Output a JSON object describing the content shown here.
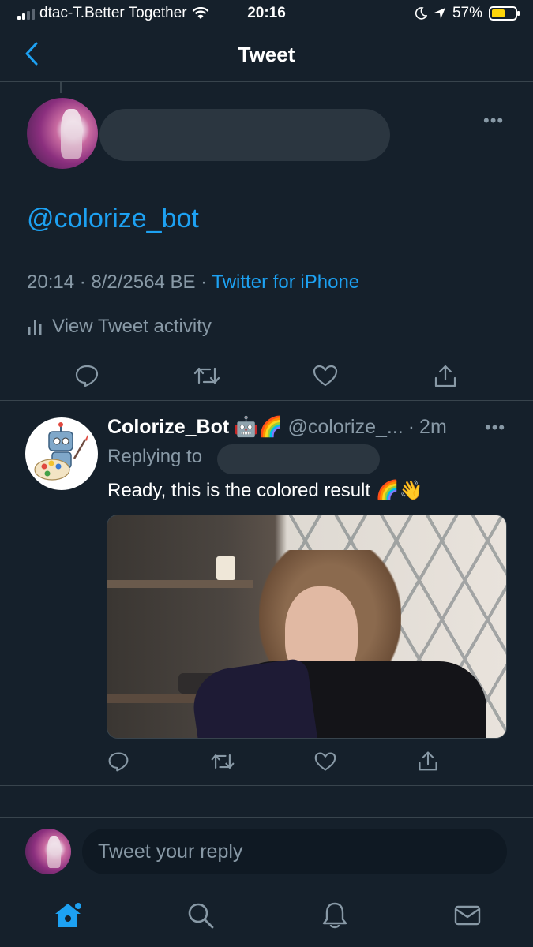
{
  "status_bar": {
    "carrier": "dtac-T.Better Together",
    "time": "20:16",
    "battery": "57%",
    "battery_level": 0.57
  },
  "nav": {
    "title": "Tweet"
  },
  "main_tweet": {
    "text": "@colorize_bot",
    "time": "20:14 · 8/2/2564 BE · ",
    "source": "Twitter for iPhone",
    "activity_label": "View Tweet activity"
  },
  "reply": {
    "name": "Colorize_Bot",
    "badges": "🤖🌈",
    "handle": "@colorize_...",
    "dot": "·",
    "time": "2m",
    "replying_to": "Replying to",
    "text": "Ready, this is the colored result 🌈👋"
  },
  "composer": {
    "placeholder": "Tweet your reply"
  },
  "colors": {
    "background": "#15202b",
    "accent": "#1da1f2",
    "secondary_text": "#8899a6",
    "divider": "#38444d"
  },
  "icons": [
    "back-chevron-icon",
    "signal-icon",
    "wifi-icon",
    "moon-icon",
    "location-arrow-icon",
    "battery-icon",
    "more-icon",
    "bar-chart-icon",
    "reply-icon",
    "retweet-icon",
    "like-icon",
    "share-icon",
    "home-icon",
    "search-icon",
    "bell-icon",
    "mail-icon"
  ]
}
